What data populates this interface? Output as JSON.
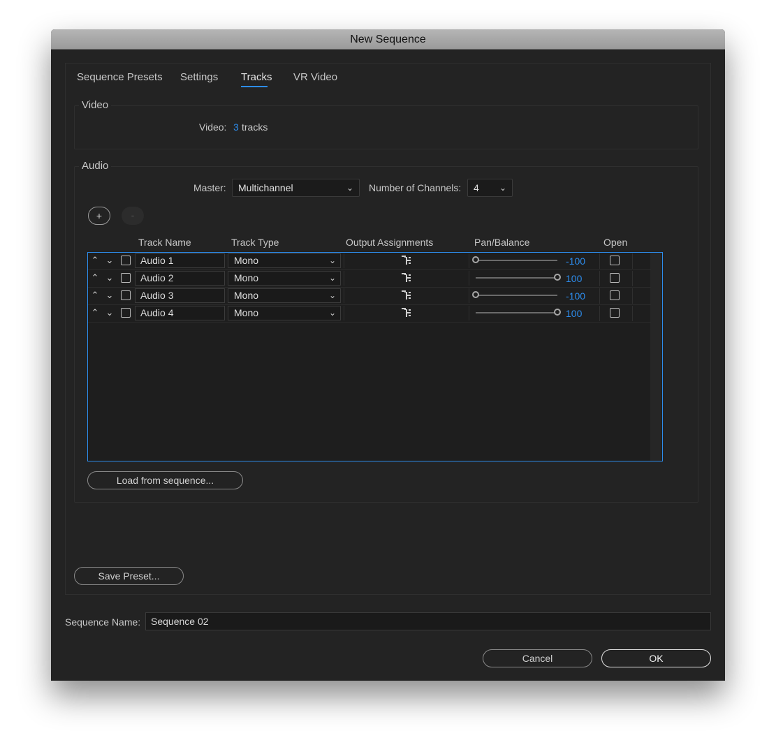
{
  "window": {
    "title": "New Sequence"
  },
  "tabs": [
    {
      "label": "Sequence Presets"
    },
    {
      "label": "Settings"
    },
    {
      "label": "Tracks"
    },
    {
      "label": "VR Video"
    }
  ],
  "active_tab": "Tracks",
  "video": {
    "group_label": "Video",
    "label": "Video:",
    "count": "3",
    "unit": "tracks"
  },
  "audio": {
    "group_label": "Audio",
    "master_label": "Master:",
    "master_value": "Multichannel",
    "channels_label": "Number of Channels:",
    "channels_value": "4",
    "add_label": "+",
    "remove_label": "-",
    "columns": [
      "Track Name",
      "Track Type",
      "Output Assignments",
      "Pan/Balance",
      "Open"
    ],
    "tracks": [
      {
        "name": "Audio 1",
        "type": "Mono",
        "pan": "-100",
        "pan_fraction": 0.0
      },
      {
        "name": "Audio 2",
        "type": "Mono",
        "pan": "100",
        "pan_fraction": 1.0
      },
      {
        "name": "Audio 3",
        "type": "Mono",
        "pan": "-100",
        "pan_fraction": 0.0
      },
      {
        "name": "Audio 4",
        "type": "Mono",
        "pan": "100",
        "pan_fraction": 1.0
      }
    ],
    "load_button": "Load from sequence..."
  },
  "save_preset_button": "Save Preset...",
  "sequence_name": {
    "label": "Sequence Name:",
    "value": "Sequence 02"
  },
  "buttons": {
    "cancel": "Cancel",
    "ok": "OK"
  },
  "colors": {
    "accent": "#2d8ceb",
    "window_bg": "#232323",
    "title_bar": "#a8a8a8"
  },
  "icons": {
    "output_assign": "routing-icon",
    "dropdown": "chevron-down-icon",
    "move_up": "chevron-up-icon",
    "move_down": "chevron-down-icon"
  }
}
